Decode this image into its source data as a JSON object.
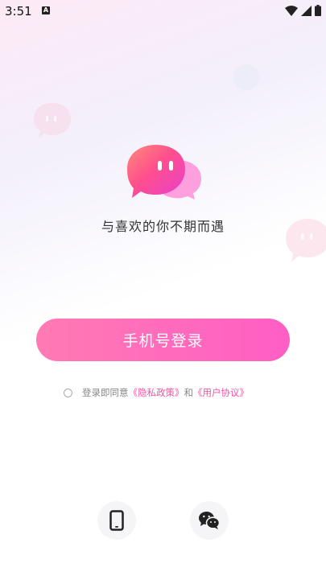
{
  "status_bar": {
    "time": "3:51",
    "notification_icon": "A"
  },
  "main": {
    "tagline": "与喜欢的你不期而遇",
    "login_button": "手机号登录"
  },
  "agreement": {
    "prefix": "登录即同意",
    "privacy_link": "《隐私政策》",
    "and": "和",
    "user_link": "《用户协议》"
  },
  "alt_login": [
    {
      "icon": "phone-icon"
    },
    {
      "icon": "wechat-icon"
    }
  ],
  "colors": {
    "accent": "#ff5ec4",
    "link": "#ff4fa3"
  }
}
